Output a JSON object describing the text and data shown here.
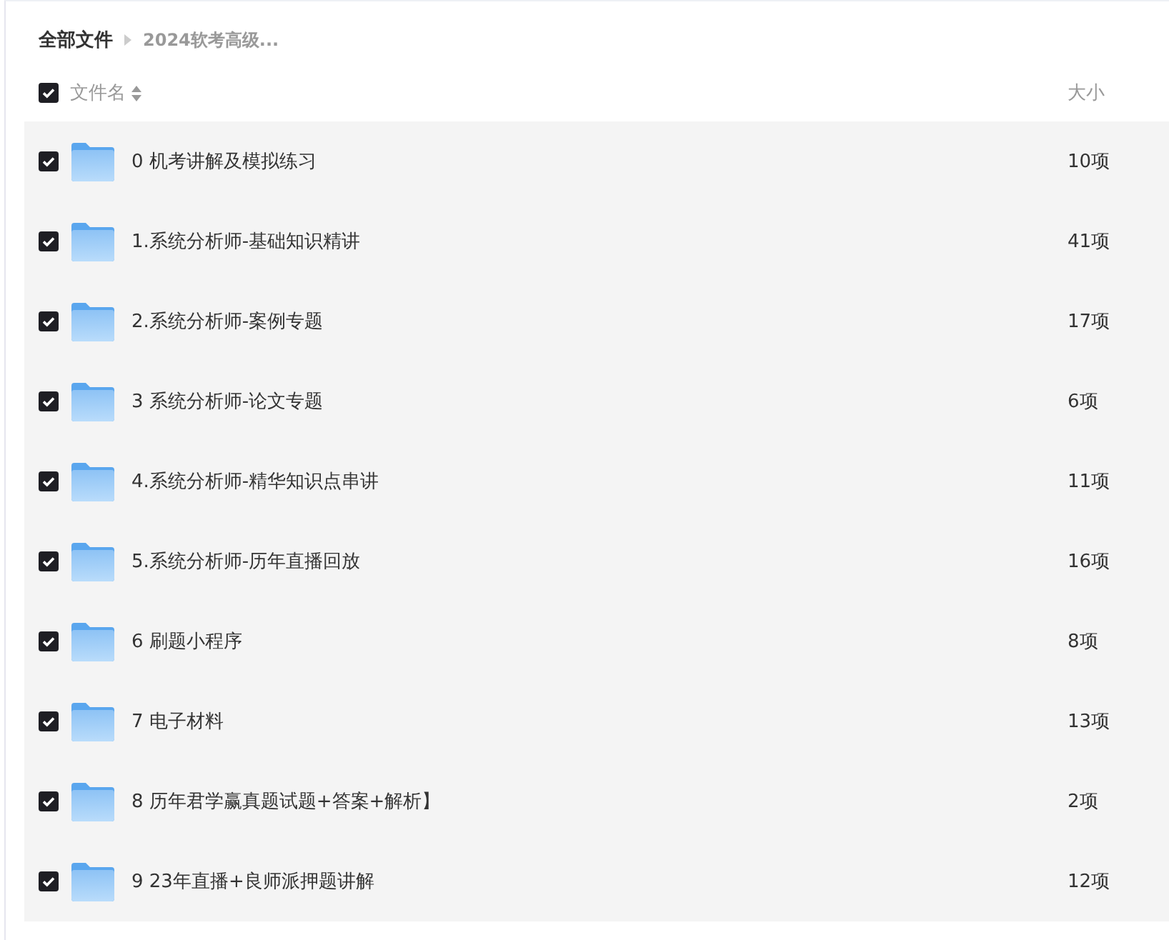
{
  "breadcrumb": [
    {
      "label": "全部文件"
    },
    {
      "label": "2024软考高级..."
    }
  ],
  "header": {
    "checked": true,
    "name_column": "文件名",
    "size_column": "大小"
  },
  "rows": [
    {
      "name": "0 机考讲解及模拟练习",
      "size": "10项",
      "checked": true
    },
    {
      "name": "1.系统分析师-基础知识精讲",
      "size": "41项",
      "checked": true
    },
    {
      "name": "2.系统分析师-案例专题",
      "size": "17项",
      "checked": true
    },
    {
      "name": "3 系统分析师-论文专题",
      "size": "6项",
      "checked": true
    },
    {
      "name": "4.系统分析师-精华知识点串讲",
      "size": "11项",
      "checked": true
    },
    {
      "name": "5.系统分析师-历年直播回放",
      "size": "16项",
      "checked": true
    },
    {
      "name": "6 刷题小程序",
      "size": "8项",
      "checked": true
    },
    {
      "name": "7 电子材料",
      "size": "13项",
      "checked": true
    },
    {
      "name": "8 历年君学赢真题试题+答案+解析】",
      "size": "2项",
      "checked": true
    },
    {
      "name": "9 23年直播+良师派押题讲解",
      "size": "12项",
      "checked": true
    }
  ]
}
